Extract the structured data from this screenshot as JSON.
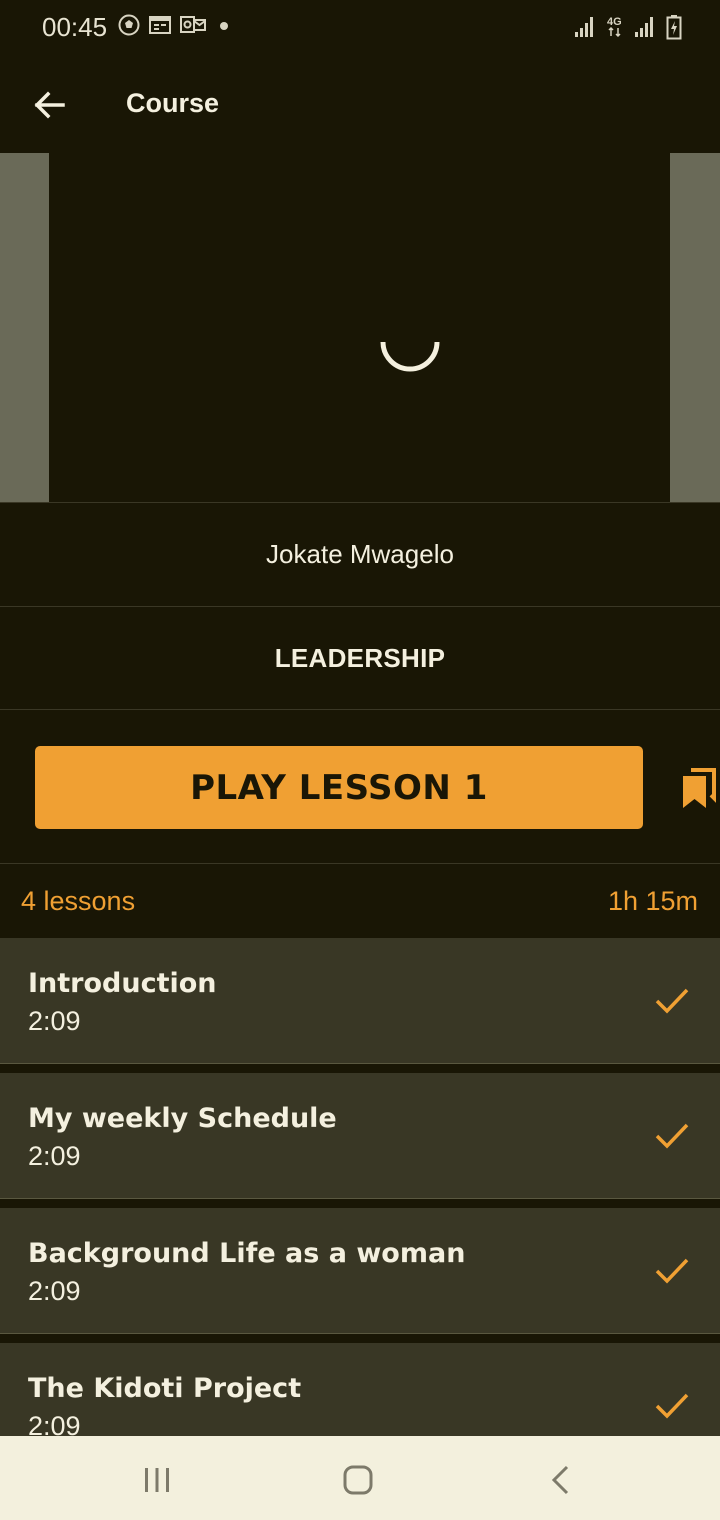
{
  "status_bar": {
    "time": "00:45",
    "network": "4G",
    "left_icons": [
      "soccer-ball-icon",
      "calendar-icon",
      "outlook-icon",
      "dot-icon"
    ],
    "right_icons": [
      "signal-icon",
      "4g-icon",
      "signal-icon",
      "battery-charging-icon"
    ]
  },
  "app_bar": {
    "title": "Course",
    "back_icon": "arrow-left-icon"
  },
  "video": {
    "state": "loading",
    "spinner_icon": "loading-spinner-icon"
  },
  "course": {
    "author": "Jokate Mwagelo",
    "category": "LEADERSHIP"
  },
  "actions": {
    "play_label": "PLAY LESSON 1",
    "bookmark_icon": "bookmark-icon"
  },
  "summary": {
    "lesson_count": "4 lessons",
    "total_duration": "1h 15m"
  },
  "lessons": [
    {
      "title": "Introduction",
      "duration": "2:09",
      "completed": true
    },
    {
      "title": "My weekly Schedule",
      "duration": "2:09",
      "completed": true
    },
    {
      "title": "Background Life as a woman",
      "duration": "2:09",
      "completed": true
    },
    {
      "title": "The Kidoti Project",
      "duration": "2:09",
      "completed": true
    }
  ],
  "nav_bar": {
    "recents_icon": "recent-apps-icon",
    "home_icon": "home-icon",
    "back_icon": "nav-back-icon"
  },
  "colors": {
    "background": "#191605",
    "accent": "#f0a033",
    "list_item": "#393725",
    "nav_bar": "#f3f0dd",
    "side_panel": "#6a6a58"
  }
}
